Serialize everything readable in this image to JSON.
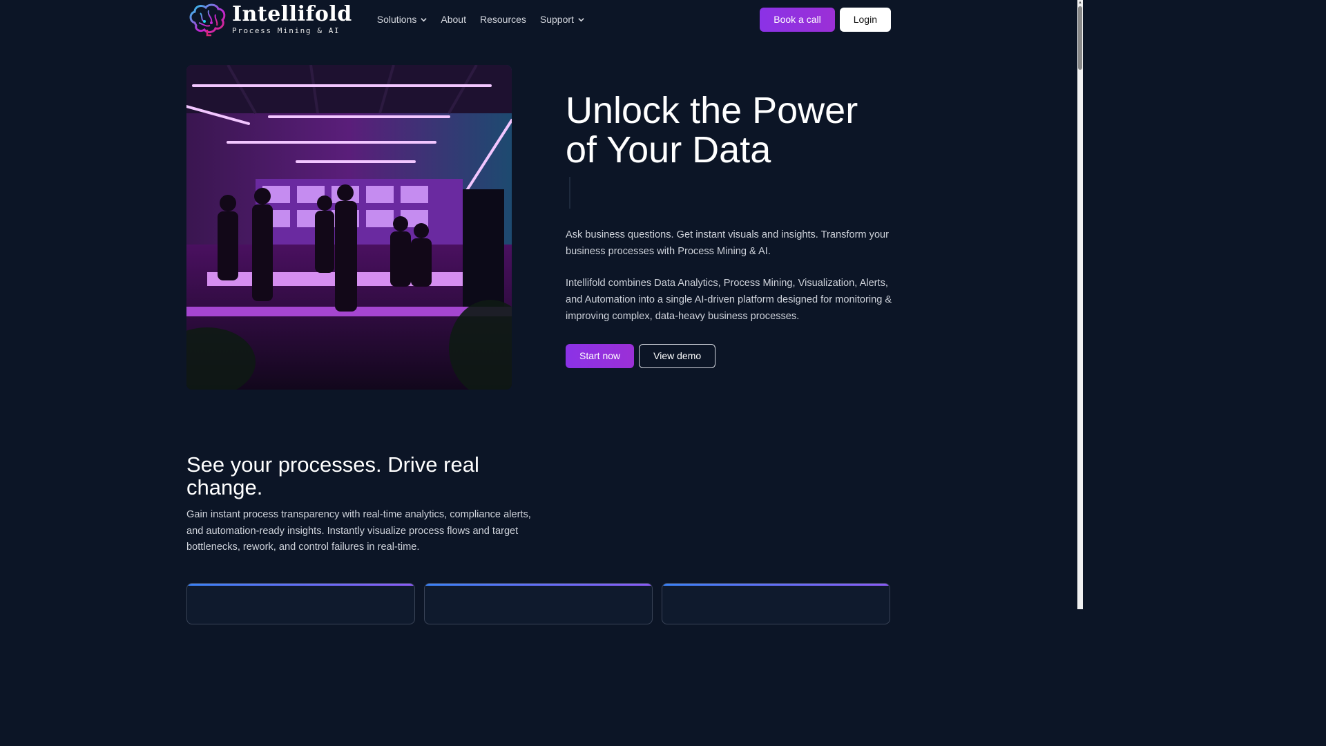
{
  "brand": {
    "name": "Intellifold",
    "tagline": "Process Mining & AI"
  },
  "nav": {
    "items": [
      {
        "label": "Solutions",
        "has_dropdown": true
      },
      {
        "label": "About",
        "has_dropdown": false
      },
      {
        "label": "Resources",
        "has_dropdown": false
      },
      {
        "label": "Support",
        "has_dropdown": true
      }
    ]
  },
  "header": {
    "book_call": "Book a call",
    "login": "Login"
  },
  "hero": {
    "title_line1": "Unlock the Power",
    "title_line2": "of Your Data",
    "paragraph1": "Ask business questions. Get instant visuals and insights. Transform your business processes with Process Mining & AI.",
    "paragraph2": "Intellifold combines Data Analytics, Process Mining, Visualization, Alerts, and Automation into a single AI-driven platform designed for monitoring & improving complex, data-heavy business processes.",
    "start_now": "Start now",
    "view_demo": "View demo"
  },
  "section": {
    "title": "See your processes. Drive real change.",
    "paragraph": "Gain instant process transparency with real-time analytics, compliance alerts, and automation-ready insights. Instantly visualize process flows and target bottlenecks, rework, and control failures in real-time."
  },
  "colors": {
    "background": "#0c1526",
    "accent": "#8b32e6",
    "text_muted": "#cfd3db"
  }
}
